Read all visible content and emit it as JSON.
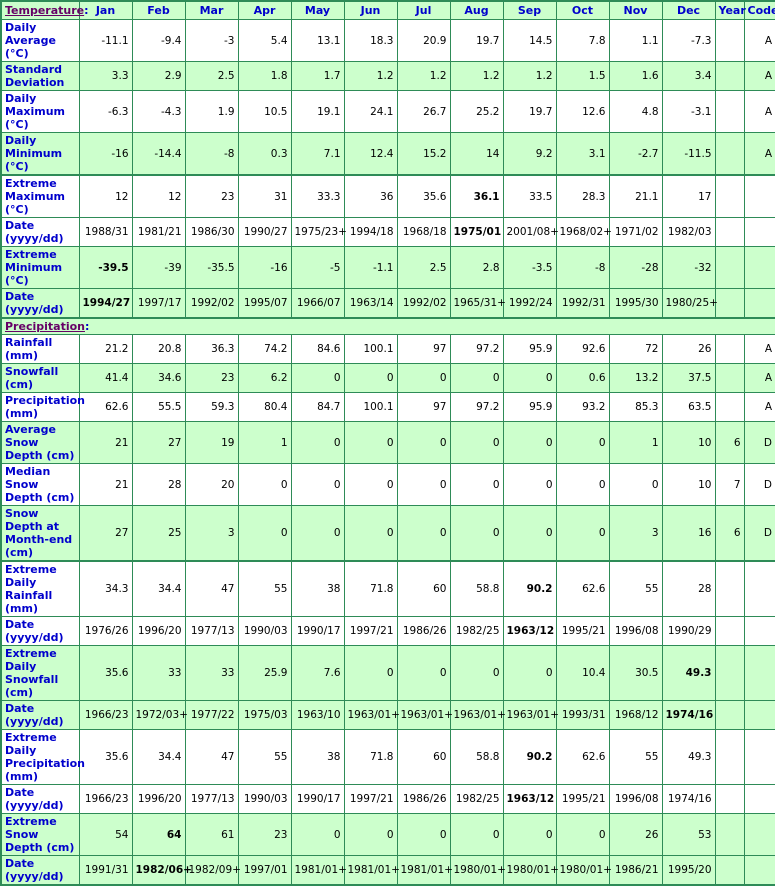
{
  "header": {
    "temperature_label": "Temperature",
    "columns": [
      "Jan",
      "Feb",
      "Mar",
      "Apr",
      "May",
      "Jun",
      "Jul",
      "Aug",
      "Sep",
      "Oct",
      "Nov",
      "Dec",
      "Year",
      "Code"
    ]
  },
  "precipitation_label": "Precipitation",
  "temperature_rows": [
    {
      "label": "Daily Average (°C)",
      "bg": "white",
      "values": [
        "-11.1",
        "-9.4",
        "-3",
        "5.4",
        "13.1",
        "18.3",
        "20.9",
        "19.7",
        "14.5",
        "7.8",
        "1.1",
        "-7.3",
        "",
        "A"
      ],
      "bold": []
    },
    {
      "label": "Standard Deviation",
      "bg": "green",
      "values": [
        "3.3",
        "2.9",
        "2.5",
        "1.8",
        "1.7",
        "1.2",
        "1.2",
        "1.2",
        "1.2",
        "1.5",
        "1.6",
        "3.4",
        "",
        "A"
      ],
      "bold": []
    },
    {
      "label": "Daily Maximum (°C)",
      "bg": "white",
      "values": [
        "-6.3",
        "-4.3",
        "1.9",
        "10.5",
        "19.1",
        "24.1",
        "26.7",
        "25.2",
        "19.7",
        "12.6",
        "4.8",
        "-3.1",
        "",
        "A"
      ],
      "bold": []
    },
    {
      "label": "Daily Minimum (°C)",
      "bg": "green",
      "values": [
        "-16",
        "-14.4",
        "-8",
        "0.3",
        "7.1",
        "12.4",
        "15.2",
        "14",
        "9.2",
        "3.1",
        "-2.7",
        "-11.5",
        "",
        "A"
      ],
      "bold": []
    },
    {
      "label": "Extreme Maximum (°C)",
      "bg": "white",
      "thick": true,
      "values": [
        "12",
        "12",
        "23",
        "31",
        "33.3",
        "36",
        "35.6",
        "36.1",
        "33.5",
        "28.3",
        "21.1",
        "17",
        "",
        ""
      ],
      "bold": [
        7
      ]
    },
    {
      "label": "Date (yyyy/dd)",
      "bg": "white",
      "values": [
        "1988/31",
        "1981/21",
        "1986/30",
        "1990/27",
        "1975/23+",
        "1994/18",
        "1968/18",
        "1975/01",
        "2001/08+",
        "1968/02+",
        "1971/02",
        "1982/03",
        "",
        ""
      ],
      "bold": [
        7
      ]
    },
    {
      "label": "Extreme Minimum (°C)",
      "bg": "green",
      "values": [
        "-39.5",
        "-39",
        "-35.5",
        "-16",
        "-5",
        "-1.1",
        "2.5",
        "2.8",
        "-3.5",
        "-8",
        "-28",
        "-32",
        "",
        ""
      ],
      "bold": [
        0
      ]
    },
    {
      "label": "Date (yyyy/dd)",
      "bg": "green",
      "values": [
        "1994/27",
        "1997/17",
        "1992/02",
        "1995/07",
        "1966/07",
        "1963/14",
        "1992/02",
        "1965/31+",
        "1992/24",
        "1992/31",
        "1995/30",
        "1980/25+",
        "",
        ""
      ],
      "bold": [
        0
      ]
    }
  ],
  "precipitation_rows": [
    {
      "label": "Rainfall (mm)",
      "bg": "white",
      "values": [
        "21.2",
        "20.8",
        "36.3",
        "74.2",
        "84.6",
        "100.1",
        "97",
        "97.2",
        "95.9",
        "92.6",
        "72",
        "26",
        "",
        "A"
      ],
      "bold": []
    },
    {
      "label": "Snowfall (cm)",
      "bg": "green",
      "values": [
        "41.4",
        "34.6",
        "23",
        "6.2",
        "0",
        "0",
        "0",
        "0",
        "0",
        "0.6",
        "13.2",
        "37.5",
        "",
        "A"
      ],
      "bold": []
    },
    {
      "label": "Precipitation (mm)",
      "bg": "white",
      "values": [
        "62.6",
        "55.5",
        "59.3",
        "80.4",
        "84.7",
        "100.1",
        "97",
        "97.2",
        "95.9",
        "93.2",
        "85.3",
        "63.5",
        "",
        "A"
      ],
      "bold": []
    },
    {
      "label": "Average Snow Depth (cm)",
      "bg": "green",
      "values": [
        "21",
        "27",
        "19",
        "1",
        "0",
        "0",
        "0",
        "0",
        "0",
        "0",
        "1",
        "10",
        "6",
        "D"
      ],
      "bold": []
    },
    {
      "label": "Median Snow Depth (cm)",
      "bg": "white",
      "values": [
        "21",
        "28",
        "20",
        "0",
        "0",
        "0",
        "0",
        "0",
        "0",
        "0",
        "0",
        "10",
        "7",
        "D"
      ],
      "bold": []
    },
    {
      "label": "Snow Depth at Month-end (cm)",
      "bg": "green",
      "values": [
        "27",
        "25",
        "3",
        "0",
        "0",
        "0",
        "0",
        "0",
        "0",
        "0",
        "3",
        "16",
        "6",
        "D"
      ],
      "bold": []
    },
    {
      "label": "Extreme Daily Rainfall (mm)",
      "bg": "white",
      "thick": true,
      "values": [
        "34.3",
        "34.4",
        "47",
        "55",
        "38",
        "71.8",
        "60",
        "58.8",
        "90.2",
        "62.6",
        "55",
        "28",
        "",
        ""
      ],
      "bold": [
        8
      ]
    },
    {
      "label": "Date (yyyy/dd)",
      "bg": "white",
      "values": [
        "1976/26",
        "1996/20",
        "1977/13",
        "1990/03",
        "1990/17",
        "1997/21",
        "1986/26",
        "1982/25",
        "1963/12",
        "1995/21",
        "1996/08",
        "1990/29",
        "",
        ""
      ],
      "bold": [
        8
      ]
    },
    {
      "label": "Extreme Daily Snowfall (cm)",
      "bg": "green",
      "values": [
        "35.6",
        "33",
        "33",
        "25.9",
        "7.6",
        "0",
        "0",
        "0",
        "0",
        "10.4",
        "30.5",
        "49.3",
        "",
        ""
      ],
      "bold": [
        11
      ]
    },
    {
      "label": "Date (yyyy/dd)",
      "bg": "green",
      "values": [
        "1966/23",
        "1972/03+",
        "1977/22",
        "1975/03",
        "1963/10",
        "1963/01+",
        "1963/01+",
        "1963/01+",
        "1963/01+",
        "1993/31",
        "1968/12",
        "1974/16",
        "",
        ""
      ],
      "bold": [
        11
      ]
    },
    {
      "label": "Extreme Daily Precipitation (mm)",
      "bg": "white",
      "values": [
        "35.6",
        "34.4",
        "47",
        "55",
        "38",
        "71.8",
        "60",
        "58.8",
        "90.2",
        "62.6",
        "55",
        "49.3",
        "",
        ""
      ],
      "bold": [
        8
      ]
    },
    {
      "label": "Date (yyyy/dd)",
      "bg": "white",
      "values": [
        "1966/23",
        "1996/20",
        "1977/13",
        "1990/03",
        "1990/17",
        "1997/21",
        "1986/26",
        "1982/25",
        "1963/12",
        "1995/21",
        "1996/08",
        "1974/16",
        "",
        ""
      ],
      "bold": [
        8
      ]
    },
    {
      "label": "Extreme Snow Depth (cm)",
      "bg": "green",
      "values": [
        "54",
        "64",
        "61",
        "23",
        "0",
        "0",
        "0",
        "0",
        "0",
        "0",
        "26",
        "53",
        "",
        ""
      ],
      "bold": [
        1
      ]
    },
    {
      "label": "Date (yyyy/dd)",
      "bg": "green",
      "values": [
        "1991/31",
        "1982/06+",
        "1982/09+",
        "1997/01",
        "1981/01+",
        "1981/01+",
        "1981/01+",
        "1980/01+",
        "1980/01+",
        "1980/01+",
        "1986/21",
        "1995/20",
        "",
        ""
      ],
      "bold": [
        1
      ]
    }
  ],
  "colors": {
    "border": "#2e8b57",
    "green_row": "#ccffcc",
    "header_text": "#0000cc",
    "section_link": "#660066"
  }
}
